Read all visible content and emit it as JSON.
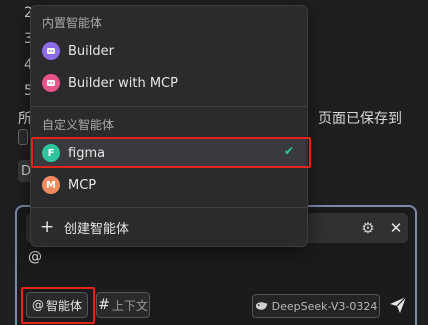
{
  "background_editor": {
    "line_numbers": [
      "2",
      "3",
      "4",
      "5"
    ],
    "line_prefix": "所",
    "saved_notice": "页面已保存到",
    "d_label": "D"
  },
  "agent_dropdown": {
    "builtin_header": "内置智能体",
    "builtin_items": [
      {
        "label": "Builder",
        "icon": "builder-icon",
        "color": "#8e6be8"
      },
      {
        "label": "Builder with MCP",
        "icon": "builder-mcp-icon",
        "color": "#e8548a"
      }
    ],
    "custom_header": "自定义智能体",
    "custom_items": [
      {
        "label": "figma",
        "avatar": "F",
        "color": "#2ec4a0",
        "selected": true
      },
      {
        "label": "MCP",
        "avatar": "M",
        "color": "#f08a5d",
        "selected": false
      }
    ],
    "create_label": "创建智能体",
    "check_mark": "✔"
  },
  "composer": {
    "at_text": "@",
    "agent_button": {
      "at": "@",
      "label": "智能体"
    },
    "context_button": {
      "hash": "#",
      "label": "上下文"
    },
    "model": "DeepSeek-V3-0324"
  },
  "colors": {
    "highlight": "#e0251c",
    "accent_check": "#2ec4a0"
  }
}
